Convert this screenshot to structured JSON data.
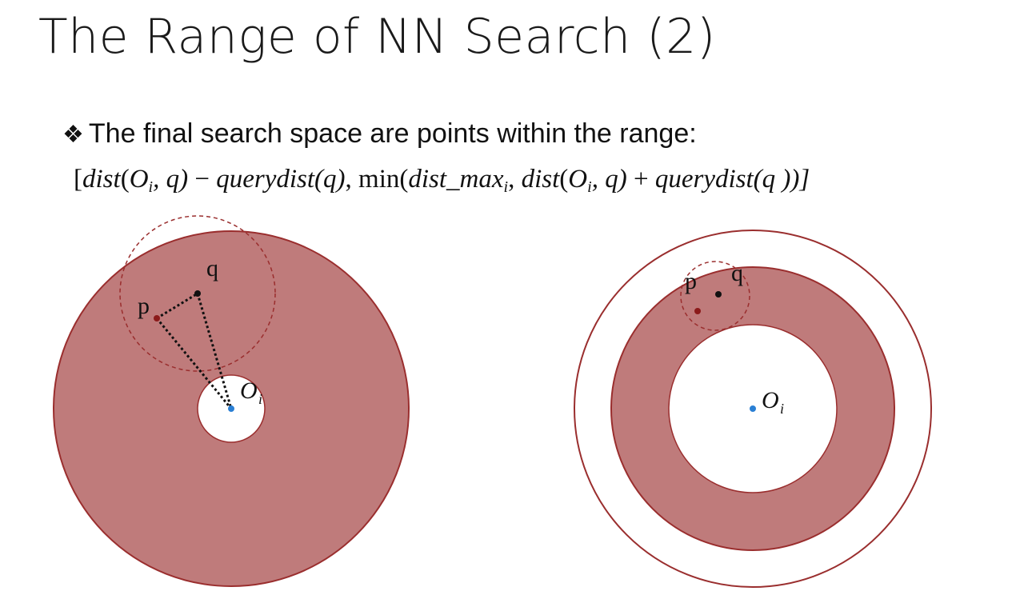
{
  "slide": {
    "title": "The Range of NN Search (2)",
    "bullet_glyph": "❖",
    "bullet_text": "The final search space are points within the range:",
    "formula": {
      "open": "[",
      "dist1": "dist",
      "p1": "(",
      "O": "O",
      "i": "i",
      "comma_q": ", q)",
      "minus": " − ",
      "qd1": "querydist",
      "q_paren1": "(q)",
      "comma": ", ",
      "min": "min",
      "p2": "(",
      "dmax": "dist_max",
      "i2": "i",
      "comma2": ", ",
      "dist2": "dist",
      "p3": "(",
      "O2": "O",
      "i3": "i",
      "comma_q2": ", q)",
      "plus": " + ",
      "qd2": "querydist",
      "q_paren2": "(q ))]"
    }
  },
  "diagram_left": {
    "label_q": "q",
    "label_p": "p",
    "label_O": "O",
    "label_i": "i"
  },
  "diagram_right": {
    "label_q": "q",
    "label_p": "p",
    "label_O": "O",
    "label_i": "i"
  },
  "colors": {
    "ring_fill": "#bf7b7b",
    "ring_stroke": "#9a2e2e",
    "query_circle_stroke": "#9a2e2e",
    "center_dot": "#2a7fd4",
    "p_dot": "#8b1a1a",
    "q_dot": "#111111"
  }
}
